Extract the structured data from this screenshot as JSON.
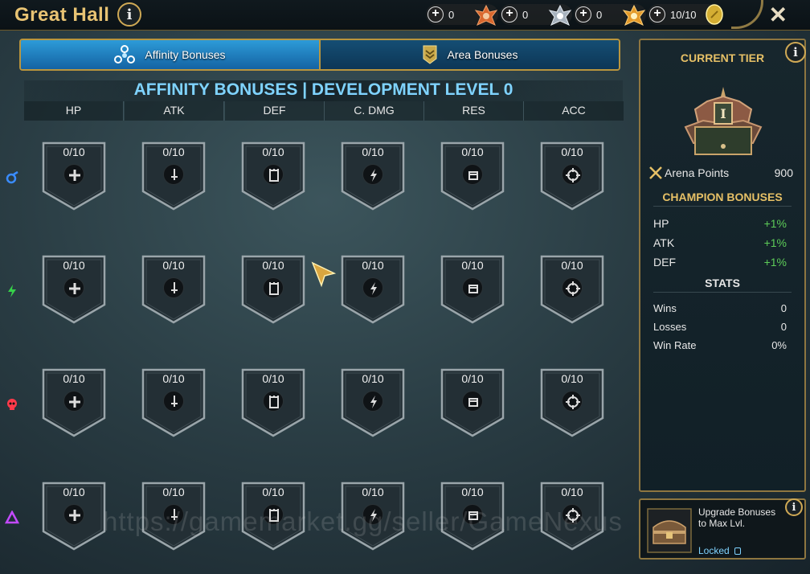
{
  "header": {
    "title": "Great Hall",
    "resources": [
      {
        "name": "bronze-medal",
        "value": "0",
        "color": "#e2763a"
      },
      {
        "name": "silver-medal",
        "value": "0",
        "color": "#bfc8d2"
      },
      {
        "name": "gold-medal",
        "value": "0",
        "color": "#e6a53a"
      },
      {
        "name": "arena-token",
        "value": "10/10",
        "color": "#e8c34a"
      }
    ]
  },
  "tabs": [
    {
      "label": "Affinity Bonuses",
      "active": true,
      "icon": "affinity-icon"
    },
    {
      "label": "Area Bonuses",
      "active": false,
      "icon": "area-icon"
    }
  ],
  "grid": {
    "title": "AFFINITY BONUSES | DEVELOPMENT LEVEL 0",
    "columns": [
      "HP",
      "ATK",
      "DEF",
      "C. DMG",
      "RES",
      "ACC"
    ],
    "rows": [
      {
        "affinity": "magic",
        "color": "#3a8cff",
        "cells": [
          "0/10",
          "0/10",
          "0/10",
          "0/10",
          "0/10",
          "0/10"
        ]
      },
      {
        "affinity": "spirit",
        "color": "#36d14a",
        "cells": [
          "0/10",
          "0/10",
          "0/10",
          "0/10",
          "0/10",
          "0/10"
        ]
      },
      {
        "affinity": "force",
        "color": "#ff3a4a",
        "cells": [
          "0/10",
          "0/10",
          "0/10",
          "0/10",
          "0/10",
          "0/10"
        ]
      },
      {
        "affinity": "void",
        "color": "#c34aff",
        "cells": [
          "0/10",
          "0/10",
          "0/10",
          "0/10",
          "0/10",
          "0/10"
        ]
      }
    ]
  },
  "panel": {
    "current_tier_label": "CURRENT TIER",
    "tier_roman": "I",
    "arena_points_label": "Arena Points",
    "arena_points_value": "900",
    "champion_bonuses_label": "CHAMPION BONUSES",
    "bonuses": [
      {
        "stat": "HP",
        "value": "+1%"
      },
      {
        "stat": "ATK",
        "value": "+1%"
      },
      {
        "stat": "DEF",
        "value": "+1%"
      }
    ],
    "stats_label": "STATS",
    "stats": [
      {
        "label": "Wins",
        "value": "0"
      },
      {
        "label": "Losses",
        "value": "0"
      },
      {
        "label": "Win Rate",
        "value": "0%"
      }
    ]
  },
  "upgrade": {
    "text_line1": "Upgrade Bonuses",
    "text_line2": "to Max Lvl.",
    "status": "Locked"
  },
  "watermark": "https://gamemarket.gg/seller/GameNexus"
}
